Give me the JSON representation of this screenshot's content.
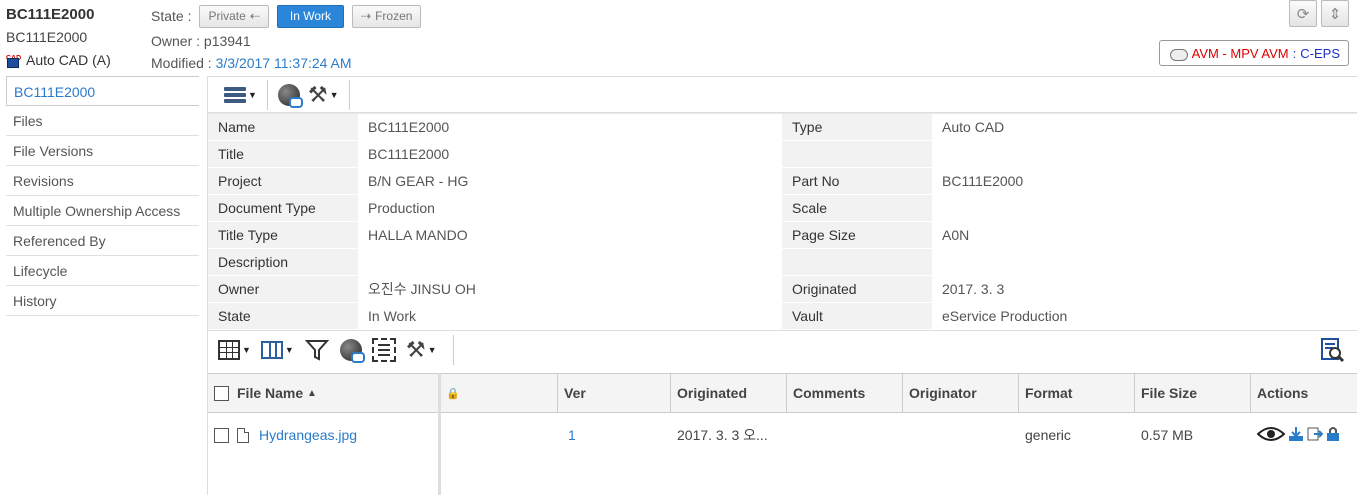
{
  "header": {
    "object_name": "BC111E2000",
    "revision": "BC111E2000",
    "type_label": "Auto CAD (A)",
    "state_label": "State :",
    "states": [
      "Private",
      "In Work",
      "Frozen"
    ],
    "owner_text": "Owner : p13941",
    "modified_label": "Modified : ",
    "modified_value": "3/3/2017 11:37:24 AM",
    "avm": {
      "part1": "AVM - MPV AVM",
      "sep": " : ",
      "part2": "C-EPS"
    }
  },
  "nav": {
    "items": [
      "BC111E2000",
      "Files",
      "File Versions",
      "Revisions",
      "Multiple Ownership Access",
      "Referenced By",
      "Lifecycle",
      "History"
    ]
  },
  "properties": {
    "rows": [
      {
        "k1": "Name",
        "v1": "BC111E2000",
        "k2": "Type",
        "v2": "Auto CAD"
      },
      {
        "k1": "Title",
        "v1": "BC111E2000",
        "k2": "",
        "v2": ""
      },
      {
        "k1": "Project",
        "v1": "B/N GEAR - HG",
        "k2": "Part No",
        "v2": "BC111E2000"
      },
      {
        "k1": "Document Type",
        "v1": "Production",
        "k2": "Scale",
        "v2": ""
      },
      {
        "k1": "Title Type",
        "v1": "HALLA MANDO",
        "k2": "Page Size",
        "v2": "A0N"
      },
      {
        "k1": "Description",
        "v1": "",
        "k2": "",
        "v2": ""
      },
      {
        "k1": "Owner",
        "v1": "오진수 JINSU OH",
        "k2": "Originated",
        "v2": "2017. 3. 3"
      },
      {
        "k1": "State",
        "v1": "In Work",
        "k2": "Vault",
        "v2": "eService Production"
      }
    ]
  },
  "files": {
    "columns": [
      "File Name",
      "",
      "Ver",
      "Originated",
      "Comments",
      "Originator",
      "Format",
      "File Size",
      "Actions"
    ],
    "sort_indicator": "▲",
    "rows": [
      {
        "name": "Hydrangeas.jpg",
        "ver": "1",
        "originated": "2017. 3. 3 오...",
        "comments": "",
        "originator": "",
        "format": "generic",
        "size": "0.57 MB"
      }
    ]
  },
  "icons": [
    "refresh-icon",
    "collapse-icon",
    "menu-icon",
    "globe-link-icon",
    "tools-icon",
    "edit-table-icon",
    "columns-icon",
    "filter-icon",
    "select-all-icon",
    "search-icon",
    "view-icon",
    "download-icon",
    "checkout-icon",
    "lock-icon"
  ]
}
